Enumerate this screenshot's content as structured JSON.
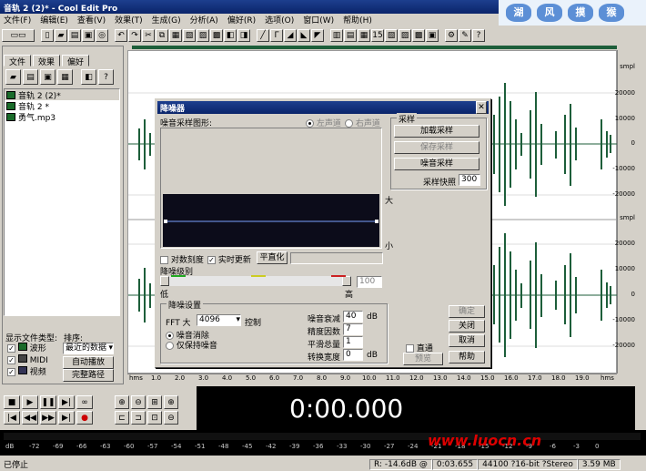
{
  "window": {
    "title": "音轨 2 (2)* - Cool Edit Pro"
  },
  "banner": [
    "湖",
    "风",
    "摸",
    "猴"
  ],
  "menu": [
    "文件(F)",
    "编辑(E)",
    "查看(V)",
    "效果(T)",
    "生成(G)",
    "分析(A)",
    "偏好(R)",
    "选项(O)",
    "窗口(W)",
    "帮助(H)"
  ],
  "sidebar": {
    "tabs": [
      "文件",
      "效果",
      "偏好"
    ],
    "files": [
      {
        "name": "音轨 2 (2)*",
        "selected": true
      },
      {
        "name": "音轨 2 *",
        "selected": false
      },
      {
        "name": "勇气.mp3",
        "selected": false
      }
    ],
    "show_types_label": "显示文件类型:",
    "sort_label": "排序:",
    "types": [
      {
        "label": "波形",
        "checked": true
      },
      {
        "label": "MIDI",
        "checked": true
      },
      {
        "label": "视频",
        "checked": true
      }
    ],
    "sort_value": "最近的数据",
    "auto_play": "自动播放",
    "full_path": "完整路径"
  },
  "ruler": {
    "top": [
      "smpl",
      "20000",
      "10000",
      "0",
      "-10000",
      "-20000"
    ],
    "bottom": [
      "smpl",
      "20000",
      "10000",
      "0",
      "-10000",
      "-20000"
    ]
  },
  "timeline": [
    "hms",
    "1.0",
    "2.0",
    "3.0",
    "4.0",
    "5.0",
    "6.0",
    "7.0",
    "8.0",
    "9.0",
    "10.0",
    "11.0",
    "12.0",
    "13.0",
    "14.0",
    "15.0",
    "16.0",
    "17.0",
    "18.0",
    "19.0",
    "hms"
  ],
  "dialog": {
    "title": "降噪器",
    "close": "✕",
    "profile_label": "噪音采样图形:",
    "left_channel": "左声道",
    "right_channel": "右声道",
    "high": "大",
    "low": "小",
    "log_scale": "对数刻度",
    "live_update": "实时更新",
    "flatten": "平直化",
    "reduction_level": "降噪级别",
    "low_word": "低",
    "high_word": "高",
    "level_value": "100",
    "sample_group": "采样",
    "load_profile": "加载采样",
    "save_profile": "保存采样",
    "get_profile": "噪音采样",
    "snapshots_label": "采样快照",
    "snapshots_value": "300",
    "settings_group": "降噪设置",
    "fft_label": "FFT 大",
    "fft_value": "4096",
    "control_label": "控制",
    "remove_noise": "噪音消除",
    "keep_noise": "仅保持噪音",
    "attenuation_label": "噪音衰减",
    "attenuation_value": "40",
    "attenuation_unit": "dB",
    "precision_label": "精度因数",
    "precision_value": "7",
    "smoothing_label": "平滑总量",
    "smoothing_value": "1",
    "transition_label": "转换宽度",
    "transition_value": "0",
    "transition_unit": "dB",
    "bypass": "直通",
    "ok": "确定",
    "close_btn": "关闭",
    "cancel": "取消",
    "help": "帮助",
    "preview": "预览"
  },
  "time_display": "0:00.000",
  "levels": [
    "dB",
    "-72",
    "-69",
    "-66",
    "-63",
    "-60",
    "-57",
    "-54",
    "-51",
    "-48",
    "-45",
    "-42",
    "-39",
    "-36",
    "-33",
    "-30",
    "-27",
    "-24",
    "-21",
    "-18",
    "-15",
    "-12",
    "-9",
    "-6",
    "-3",
    "0"
  ],
  "status": {
    "state": "已停止",
    "level": "R: -14.6dB @",
    "time": "0:03.655",
    "format": "44100 ?16-bit ?Stereo",
    "size": "3.59 MB"
  },
  "watermark": "www.luocn.cn",
  "colors": {
    "title": "#0a246a",
    "wave": "#1d5e3a",
    "face": "#d4d0c8"
  }
}
